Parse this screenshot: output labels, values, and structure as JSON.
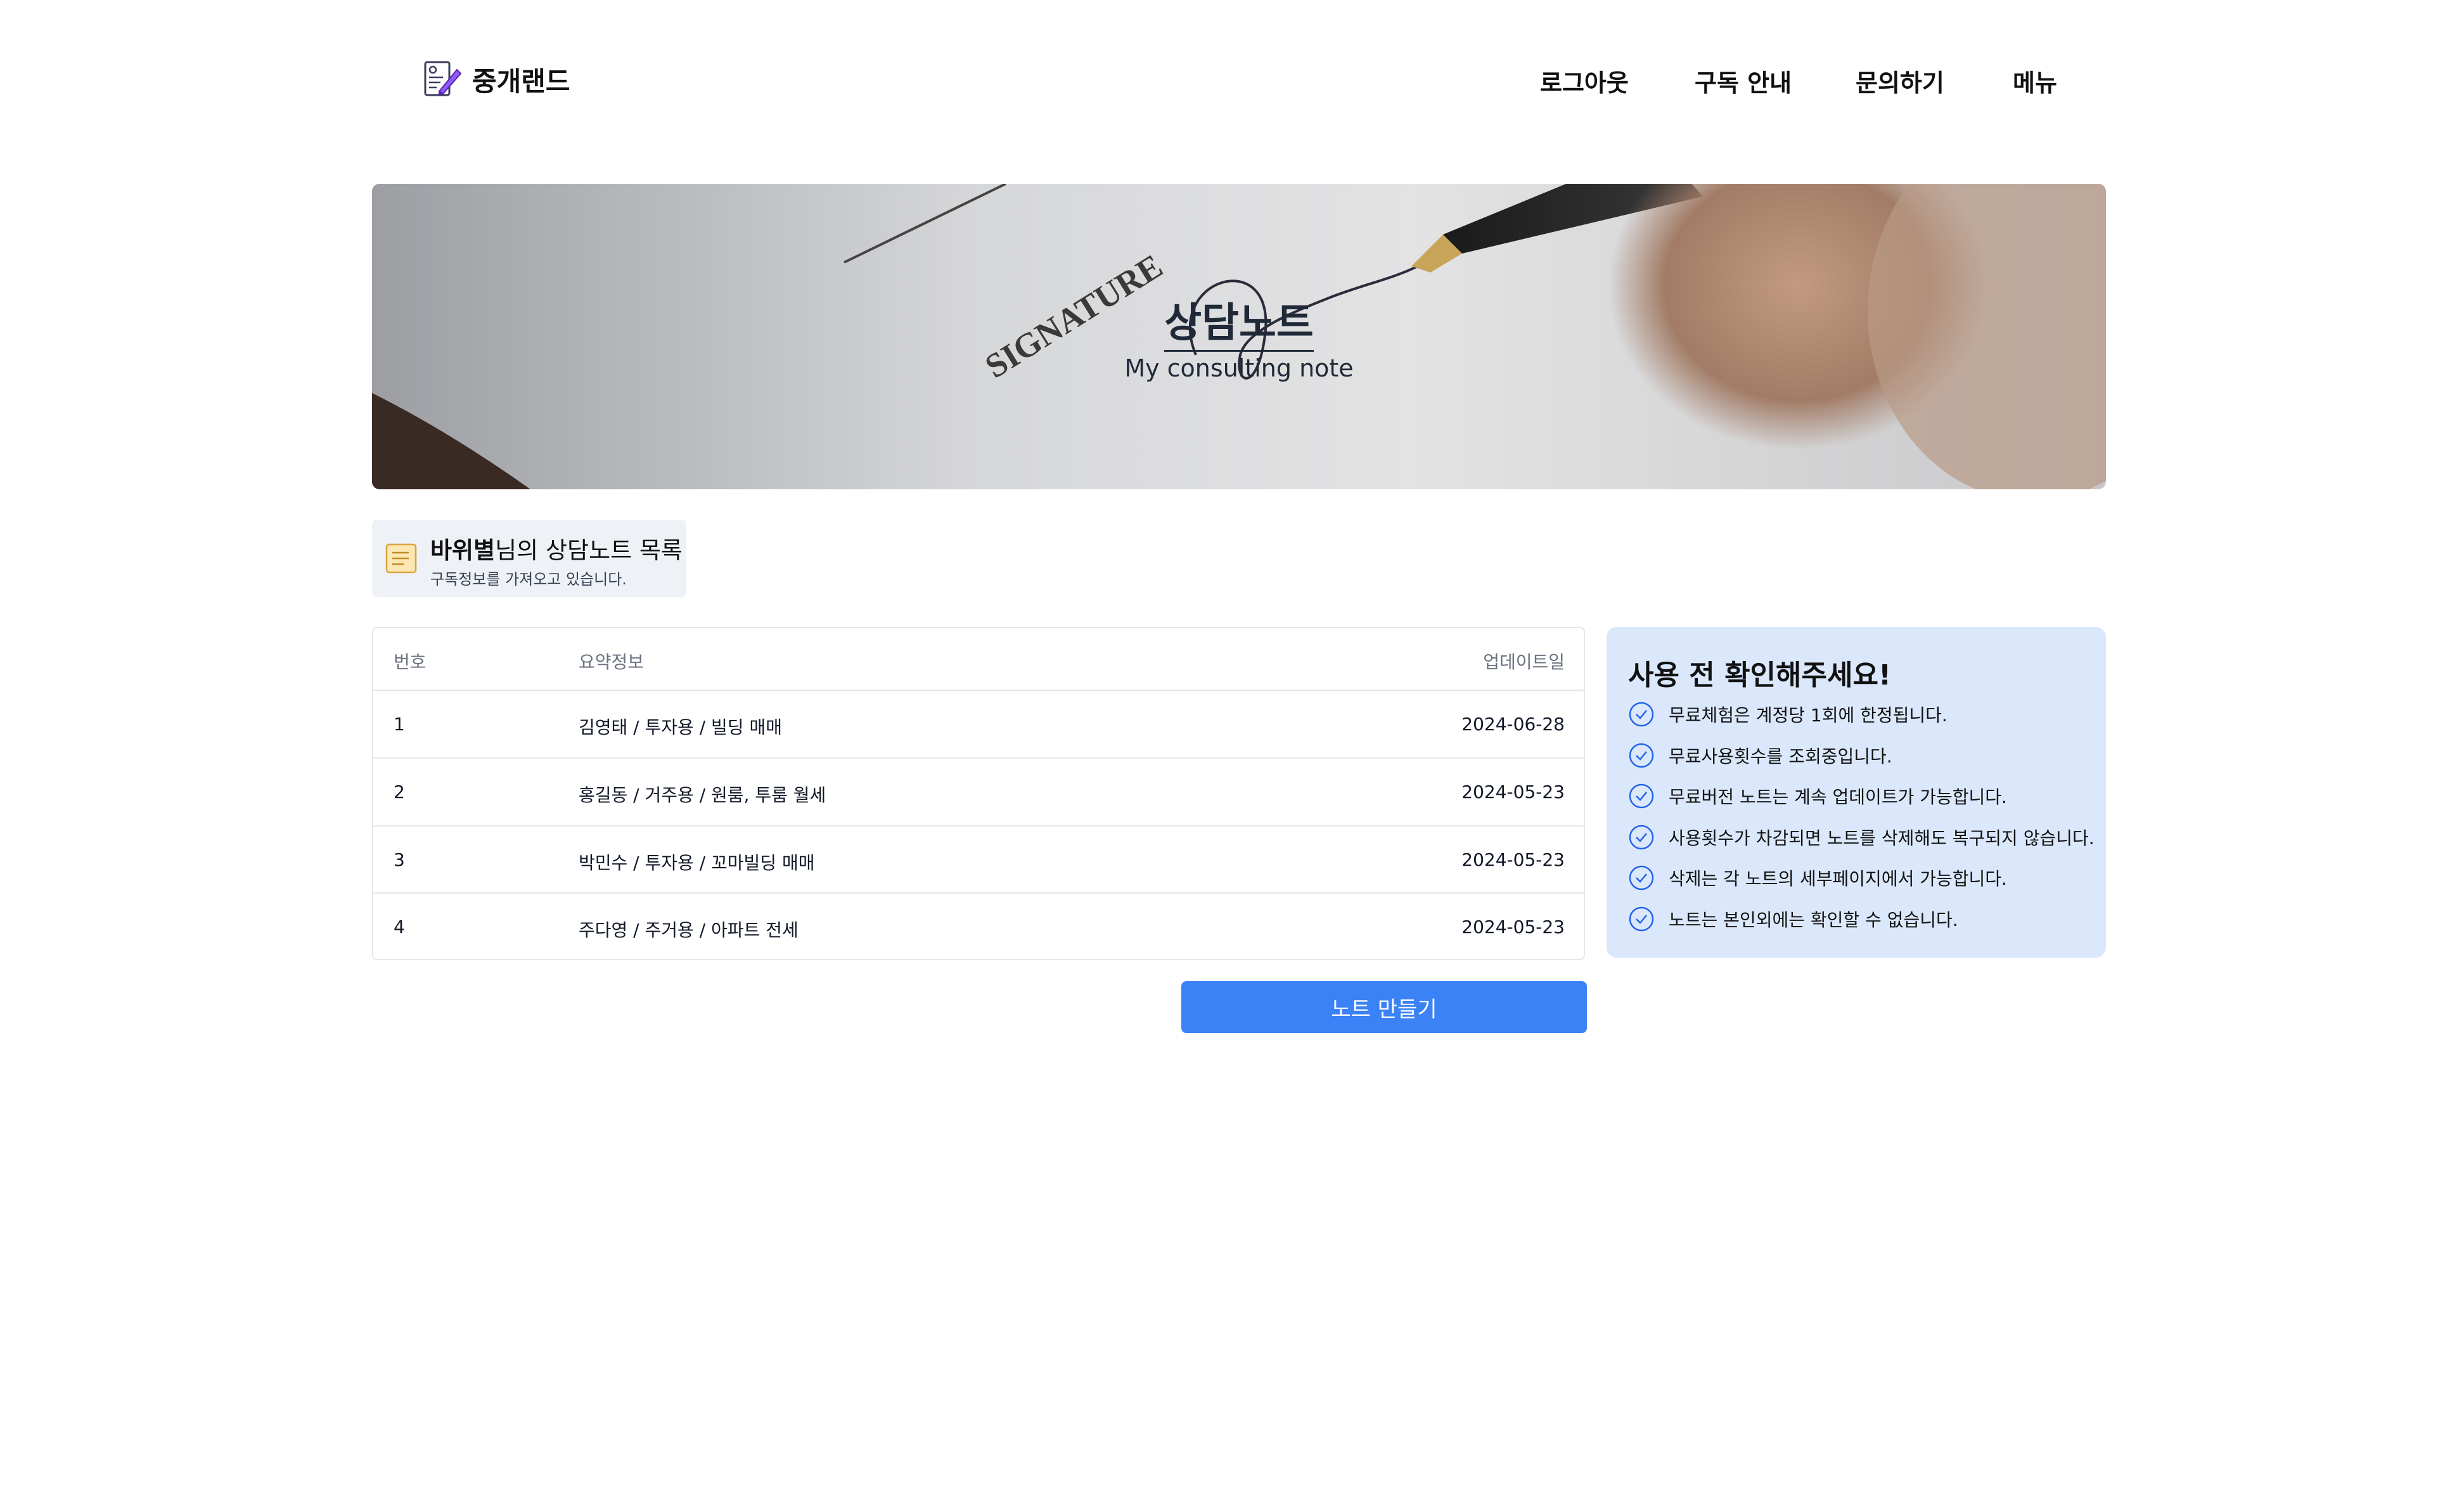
{
  "header": {
    "brand": "중개랜드",
    "nav": [
      "로그아웃",
      "구독 안내",
      "문의하기",
      "메뉴"
    ]
  },
  "banner": {
    "title": "상담노트",
    "subtitle": "My consulting note"
  },
  "owner": {
    "name": "바위별",
    "title_suffix": "님의 상담노트 목록",
    "status": "구독정보를 가져오고 있습니다."
  },
  "table": {
    "columns": [
      "번호",
      "요약정보",
      "업데이트일"
    ],
    "rows": [
      {
        "no": "1",
        "summary": "김영태 / 투자용 / 빌딩 매매",
        "date": "2024-06-28"
      },
      {
        "no": "2",
        "summary": "홍길동 / 거주용 / 원룸, 투룸 월세",
        "date": "2024-05-23"
      },
      {
        "no": "3",
        "summary": "박민수 / 투자용 / 꼬마빌딩 매매",
        "date": "2024-05-23"
      },
      {
        "no": "4",
        "summary": "주다영 / 주거용 / 아파트 전세",
        "date": "2024-05-23"
      }
    ]
  },
  "make_button": "노트 만들기",
  "notice": {
    "title": "사용 전 확인해주세요!",
    "items": [
      "무료체험은 계정당 1회에 한정됩니다.",
      "무료사용횟수를 조회중입니다.",
      "무료버전 노트는 계속 업데이트가 가능합니다.",
      "사용횟수가 차감되면 노트를 삭제해도 복구되지 않습니다.",
      "삭제는 각 노트의 세부페이지에서 가능합니다.",
      "노트는 본인외에는 확인할 수 없습니다."
    ]
  },
  "colors": {
    "accent": "#3b82f6",
    "notice_bg": "#dbe8fc",
    "owner_bg": "#eef2f7",
    "check_icon": "#2563eb"
  },
  "icons": {
    "logo": "document-pen-icon",
    "owner": "memo-note-icon",
    "notice_item": "check-circle-icon"
  }
}
